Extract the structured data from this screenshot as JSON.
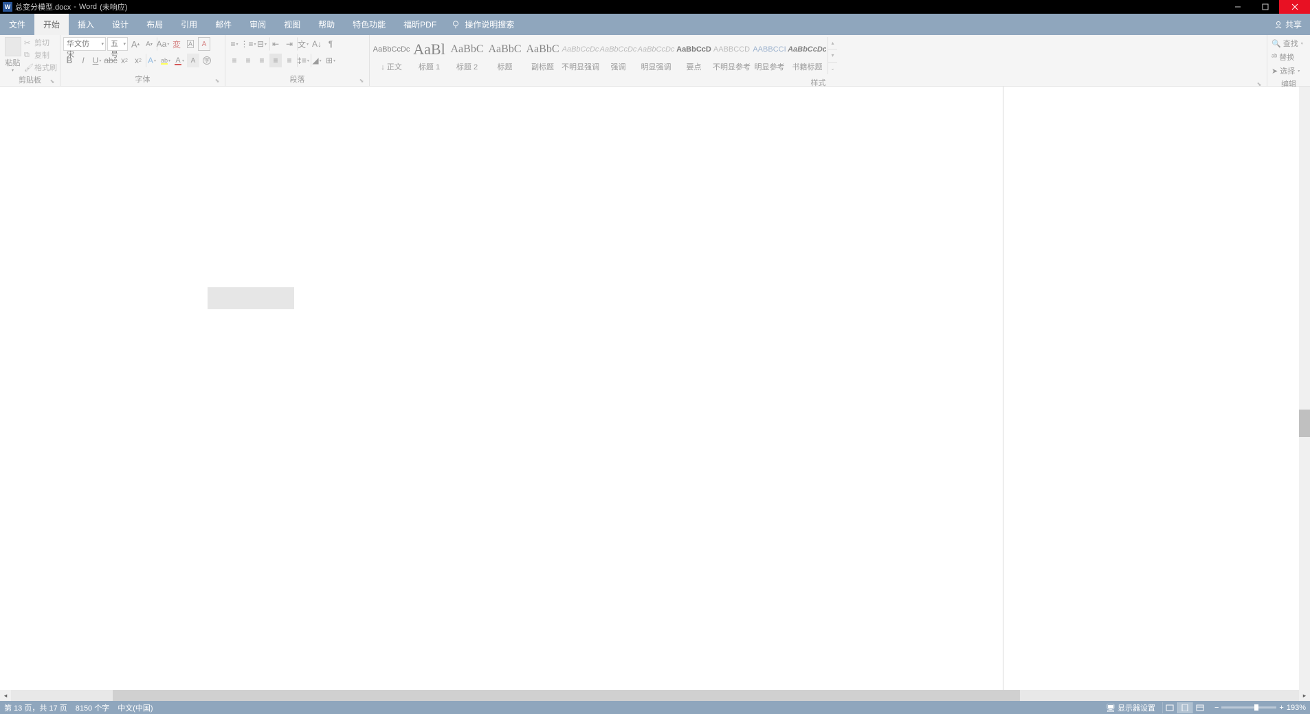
{
  "title": {
    "filename": "总变分模型.docx",
    "app": "Word",
    "state": "(未响应)"
  },
  "windowControls": {
    "minimize": "—",
    "maximize": "□",
    "close": "×"
  },
  "menu": {
    "file": "文件",
    "home": "开始",
    "insert": "插入",
    "design": "设计",
    "layout": "布局",
    "references": "引用",
    "mailings": "邮件",
    "review": "审阅",
    "view": "视图",
    "help": "帮助",
    "special": "特色功能",
    "foxit": "福昕PDF",
    "tellme": "操作说明搜索"
  },
  "share": "共享",
  "ribbon": {
    "clipboard": {
      "paste": "粘贴",
      "cut": "剪切",
      "copy": "复制",
      "formatPainter": "格式刷",
      "label": "剪贴板"
    },
    "font": {
      "name": "华文仿宋",
      "size": "五号",
      "label": "字体"
    },
    "paragraph": {
      "label": "段落"
    },
    "styles": {
      "label": "样式",
      "items": [
        {
          "preview": "AaBbCcDc",
          "name": "↓ 正文",
          "cls": ""
        },
        {
          "preview": "AaBl",
          "name": "标题 1",
          "cls": "big"
        },
        {
          "preview": "AaBbC",
          "name": "标题 2",
          "cls": "med"
        },
        {
          "preview": "AaBbC",
          "name": "标题",
          "cls": "med"
        },
        {
          "preview": "AaBbC",
          "name": "副标题",
          "cls": "med"
        },
        {
          "preview": "AaBbCcDc",
          "name": "不明显强调",
          "cls": "italic"
        },
        {
          "preview": "AaBbCcDc",
          "name": "强调",
          "cls": "italic"
        },
        {
          "preview": "AaBbCcDc",
          "name": "明显强调",
          "cls": "italic"
        },
        {
          "preview": "AaBbCcD",
          "name": "要点",
          "cls": "bold"
        },
        {
          "preview": "AABBCCD",
          "name": "不明显参考",
          "cls": "sc"
        },
        {
          "preview": "AABBCCI",
          "name": "明显参考",
          "cls": "blue"
        },
        {
          "preview": "AaBbCcDc",
          "name": "书籍标题",
          "cls": "bolditalic"
        }
      ]
    },
    "editing": {
      "find": "查找",
      "replace": "替换",
      "select": "选择",
      "label": "编辑"
    }
  },
  "status": {
    "page": "第 13 页，共 17 页",
    "words": "8150 个字",
    "language": "中文(中国)",
    "displaySettings": "显示器设置",
    "zoom": "193%"
  }
}
